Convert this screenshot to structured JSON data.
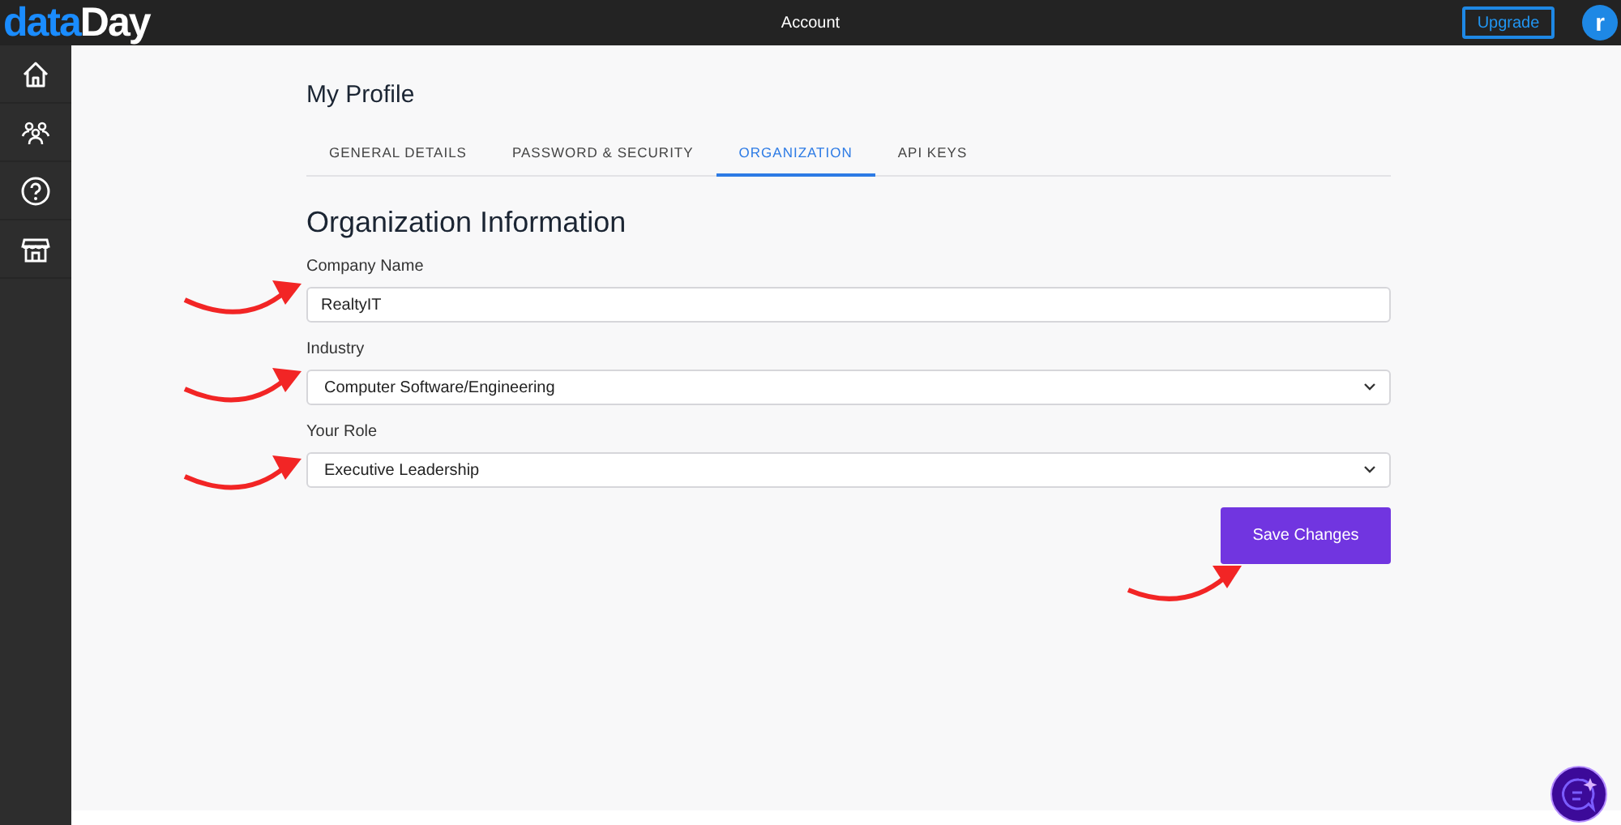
{
  "header": {
    "brand_primary": "data",
    "brand_secondary": "Day",
    "title": "Account",
    "upgrade_button": "Upgrade",
    "avatar": "r"
  },
  "sidebar": {
    "items": [
      {
        "kind": "home",
        "selected": false
      },
      {
        "kind": "people",
        "selected": false
      },
      {
        "kind": "help",
        "selected": false
      },
      {
        "kind": "store",
        "selected": false
      }
    ]
  },
  "page_title": "My Profile",
  "tabs": [
    {
      "label": "GENERAL DETAILS",
      "selected": false
    },
    {
      "label": "PASSWORD & SECURITY",
      "selected": false
    },
    {
      "label": "ORGANIZATION",
      "selected": true
    },
    {
      "label": "API KEYS",
      "selected": false
    }
  ],
  "section_title": "Organization Information",
  "fields": [
    {
      "kind": "text",
      "label": "Company Name",
      "value": "RealtyIT"
    },
    {
      "kind": "select",
      "label": "Industry",
      "value": "Computer Software/Engineering"
    },
    {
      "kind": "select",
      "label": "Your Role",
      "value": "Executive Leadership"
    }
  ],
  "save_button": "Save Changes"
}
